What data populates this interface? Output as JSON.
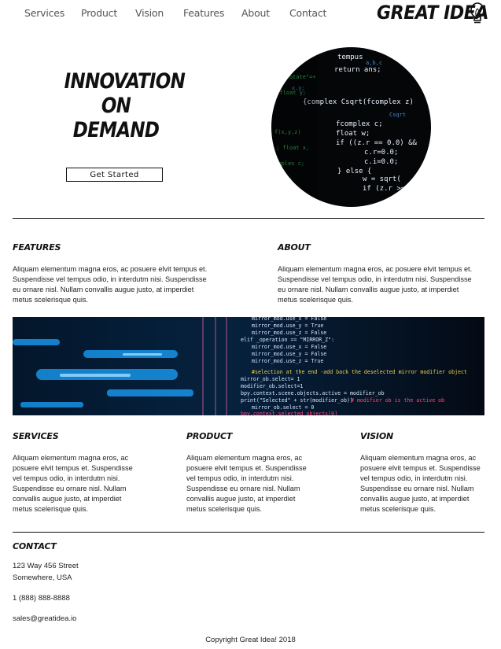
{
  "nav": {
    "items": [
      "Services",
      "Product",
      "Vision",
      "Features",
      "About",
      "Contact"
    ],
    "logo": "GREAT IDEA"
  },
  "hero": {
    "title_lines": [
      "Innovation",
      "on",
      "Demand"
    ],
    "cta_label": "Get Started",
    "image_icon": "code-screen-icon"
  },
  "features": {
    "title": "Features",
    "body": "Aliquam elementum magna eros, ac posuere elvit tempus et. Suspendisse vel tempus odio, in interdutm nisi. Suspendisse eu ornare nisl. Nullam convallis augue justo, at imperdiet metus scelerisque quis."
  },
  "about": {
    "title": "About",
    "body": "Aliquam elementum magna eros, ac posuere elvit tempus et. Suspendisse vel tempus odio, in interdutm nisi. Suspendisse eu ornare nisl. Nullam convallis augue justo, at imperdiet metus scelerisque quis."
  },
  "band": {
    "image_icon": "code-editor-banner"
  },
  "columns": [
    {
      "title": "Services",
      "body": "Aliquam elementum magna eros, ac posuere elvit tempus et. Suspendisse vel tempus odio, in interdutm nisi. Suspendisse eu ornare nisl. Nullam convallis augue justo, at imperdiet metus scelerisque quis."
    },
    {
      "title": "Product",
      "body": "Aliquam elementum magna eros, ac posuere elvit tempus et. Suspendisse vel tempus odio, in interdutm nisi. Suspendisse eu ornare nisl. Nullam convallis augue justo, at imperdiet metus scelerisque quis."
    },
    {
      "title": "Vision",
      "body": "Aliquam elementum magna eros, ac posuere elvit tempus et. Suspendisse vel tempus odio, in interdutm nisi. Suspendisse eu ornare nisl. Nullam convallis augue justo, at imperdiet metus scelerisque quis."
    }
  ],
  "contact": {
    "title": "Contact",
    "address_line1": "123 Way 456 Street",
    "address_line2": "Somewhere, USA",
    "phone": "1 (888) 888-8888",
    "email": "sales@greatidea.io"
  },
  "footer": {
    "copyright": "Copyright Great Idea! 2018"
  }
}
